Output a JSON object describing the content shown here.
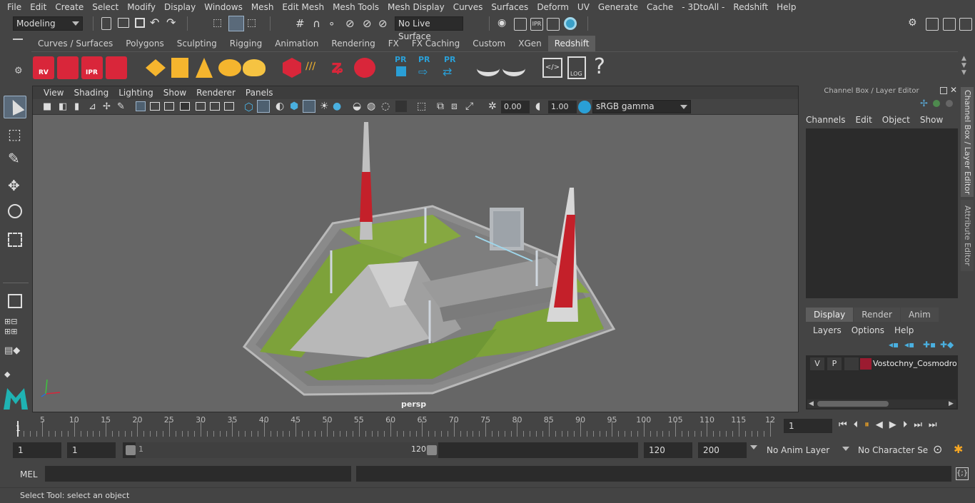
{
  "menubar": {
    "items": [
      "File",
      "Edit",
      "Create",
      "Select",
      "Modify",
      "Display",
      "Windows",
      "Mesh",
      "Edit Mesh",
      "Mesh Tools",
      "Mesh Display",
      "Curves",
      "Surfaces",
      "Deform",
      "UV",
      "Generate",
      "Cache",
      "- 3DtoAll -",
      "Redshift",
      "Help"
    ]
  },
  "statusline": {
    "mode": "Modeling",
    "live_surface": "No Live Surface"
  },
  "shelf": {
    "tabs": [
      "Curves / Surfaces",
      "Polygons",
      "Sculpting",
      "Rigging",
      "Animation",
      "Rendering",
      "FX",
      "FX Caching",
      "Custom",
      "XGen",
      "Redshift"
    ],
    "active_tab": "Redshift",
    "icon_labels": {
      "rv": "RV",
      "ipr": "IPR",
      "pr1": "PR",
      "pr2": "PR",
      "pr3": "PR",
      "log": "LOG",
      "help": "?"
    }
  },
  "viewport": {
    "menu": [
      "View",
      "Shading",
      "Lighting",
      "Show",
      "Renderer",
      "Panels"
    ],
    "exposure": "0.00",
    "gamma": "1.00",
    "color_space": "sRGB gamma",
    "camera": "persp"
  },
  "channelbox": {
    "title": "Channel Box / Layer Editor",
    "menu": [
      "Channels",
      "Edit",
      "Object",
      "Show"
    ],
    "display_tabs": [
      "Display",
      "Render",
      "Anim"
    ],
    "active_display_tab": "Display",
    "layer_menu": [
      "Layers",
      "Options",
      "Help"
    ],
    "layer": {
      "v": "V",
      "p": "P",
      "name": "Vostochny_Cosmodrome",
      "color": "#9b1b30"
    }
  },
  "sidetabs": [
    "Channel Box / Layer Editor",
    "Attribute Editor"
  ],
  "timeline": {
    "ticks": [
      "5",
      "10",
      "15",
      "20",
      "25",
      "30",
      "35",
      "40",
      "45",
      "50",
      "55",
      "60",
      "65",
      "70",
      "75",
      "80",
      "85",
      "90",
      "95",
      "100",
      "105",
      "110",
      "115",
      "12"
    ],
    "current_frame_marker": "1",
    "current_frame": "1"
  },
  "range": {
    "start": "1",
    "playback_start": "1",
    "slider_start": "1",
    "slider_end": "120",
    "playback_end": "120",
    "end": "200",
    "anim_layer": "No Anim Layer",
    "character_set": "No Character Set"
  },
  "mel": {
    "label": "MEL"
  },
  "helpline": {
    "text": "Select Tool: select an object"
  },
  "colors": {
    "accent_blue": "#2a9fd6",
    "redshift_red": "#d9263a",
    "maya_teal": "#1fb3b3"
  }
}
